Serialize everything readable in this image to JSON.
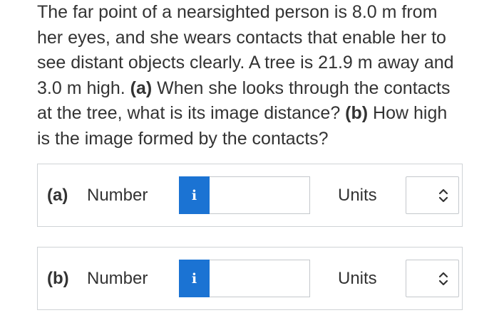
{
  "question": {
    "lines": [
      [
        {
          "text": "The far point of a nearsighted person is 8.0 m from",
          "bold": false
        }
      ],
      [
        {
          "text": "her eyes, and she wears contacts that enable her to",
          "bold": false
        }
      ],
      [
        {
          "text": "see distant objects clearly. A tree is 21.9 m away and",
          "bold": false
        }
      ],
      [
        {
          "text": "3.0 m high. ",
          "bold": false
        },
        {
          "text": "(a)",
          "bold": true
        },
        {
          "text": " When she looks through the contacts",
          "bold": false
        }
      ],
      [
        {
          "text": "at the tree, what is its image distance? ",
          "bold": false
        },
        {
          "text": "(b)",
          "bold": true
        },
        {
          "text": " How high",
          "bold": false
        }
      ],
      [
        {
          "text": "is the image formed by the contacts?",
          "bold": false
        }
      ]
    ]
  },
  "parts": [
    {
      "part_label": "(a)",
      "number_label": "Number",
      "info_icon": "i",
      "number_value": "",
      "units_label": "Units",
      "units_value": "",
      "units_icon": "chevron-up-down-icon"
    },
    {
      "part_label": "(b)",
      "number_label": "Number",
      "info_icon": "i",
      "number_value": "",
      "units_label": "Units",
      "units_value": "",
      "units_icon": "chevron-up-down-icon"
    }
  ],
  "colors": {
    "info_button": "#1b73d3",
    "text": "#333333",
    "border": "#cfd3d6"
  }
}
